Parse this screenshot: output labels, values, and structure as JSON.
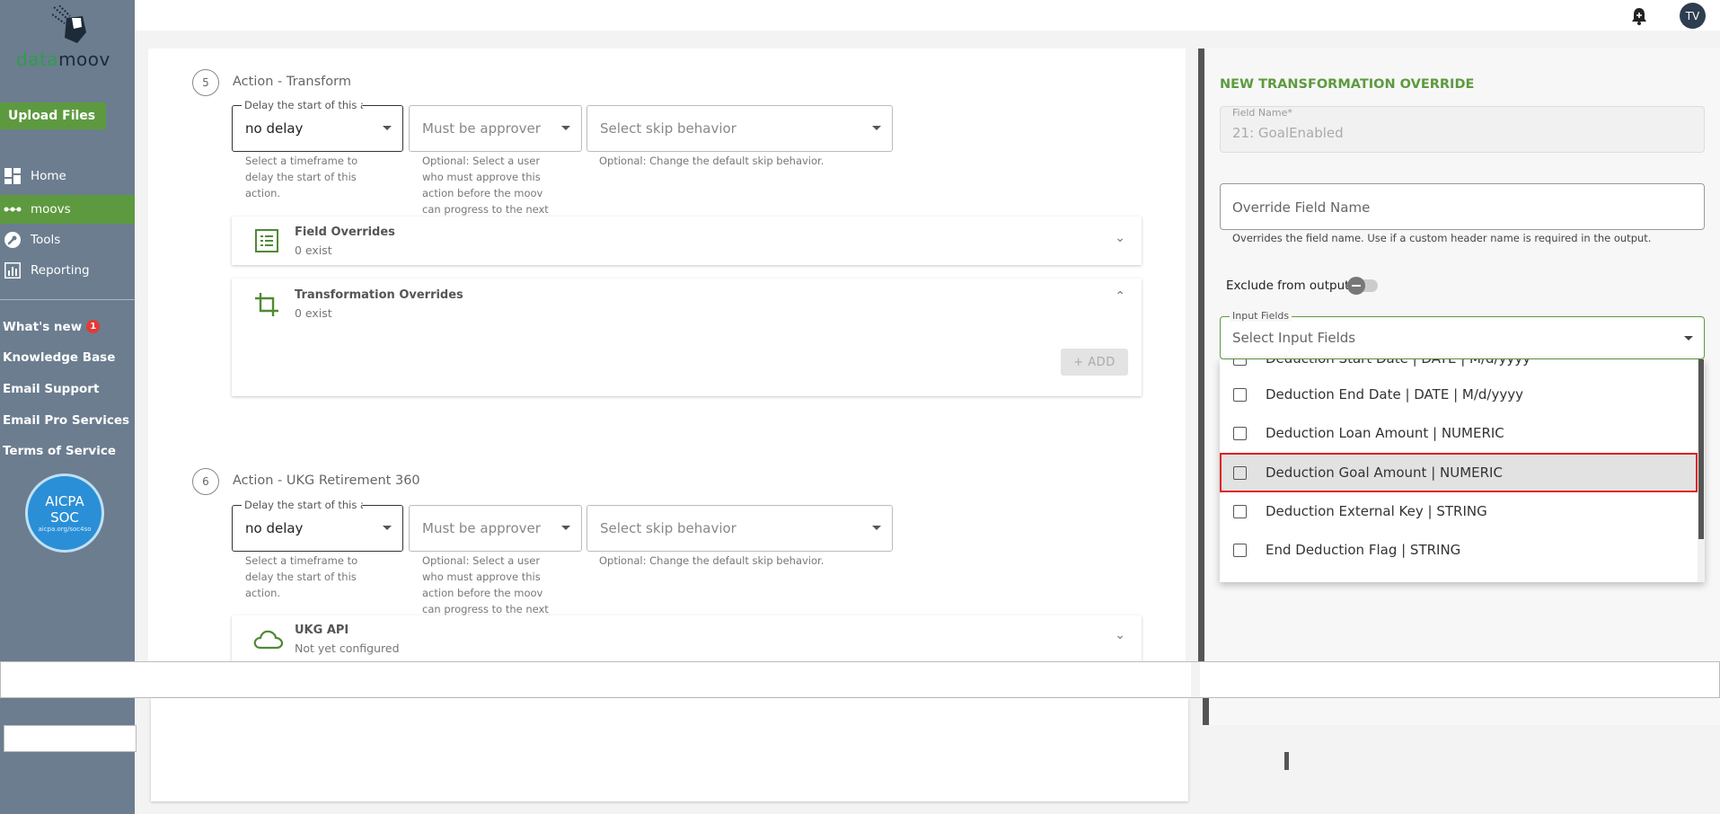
{
  "brand": {
    "logo_part1": "data",
    "logo_part2": "moov"
  },
  "sidebar": {
    "upload_label": "Upload Files",
    "nav": [
      {
        "label": "Home",
        "icon": "dashboard-icon"
      },
      {
        "label": "moovs",
        "icon": "dots-icon"
      },
      {
        "label": "Tools",
        "icon": "wrench-icon"
      },
      {
        "label": "Reporting",
        "icon": "bar-chart-icon"
      }
    ],
    "links": [
      {
        "label": "What's new",
        "badge": "1"
      },
      {
        "label": "Knowledge Base"
      },
      {
        "label": "Email Support"
      },
      {
        "label": "Email Pro Services"
      },
      {
        "label": "Terms of Service"
      }
    ],
    "aicpa": {
      "line1": "AICPA",
      "line2": "SOC",
      "sub": "aicpa.org/soc4so"
    }
  },
  "header": {
    "avatar_initials": "TV"
  },
  "actions": [
    {
      "number": "5",
      "title": "Action - Transform",
      "delay_label": "Delay the start of this action",
      "delay_value": "no delay",
      "delay_help": "Select a timeframe to delay the start of this action.",
      "approver_placeholder": "Must be approver",
      "approver_help": "Optional: Select a user who must approve this action before the moov can progress to the next",
      "skip_placeholder": "Select skip behavior",
      "skip_help": "Optional: Change the default skip behavior.",
      "cards": [
        {
          "title": "Field Overrides",
          "sub": "0 exist"
        },
        {
          "title": "Transformation Overrides",
          "sub": "0 exist",
          "add_label": "+ ADD"
        }
      ]
    },
    {
      "number": "6",
      "title": "Action - UKG Retirement 360",
      "delay_label": "Delay the start of this action",
      "delay_value": "no delay",
      "delay_help": "Select a timeframe to delay the start of this action.",
      "approver_placeholder": "Must be approver",
      "approver_help": "Optional: Select a user who must approve this action before the moov can progress to the next",
      "skip_placeholder": "Select skip behavior",
      "skip_help": "Optional: Change the default skip behavior.",
      "cards": [
        {
          "title": "UKG API",
          "sub": "Not yet configured"
        }
      ]
    }
  ],
  "override_panel": {
    "title": "NEW TRANSFORMATION OVERRIDE",
    "field_name_label": "Field Name*",
    "field_name_value": "21: GoalEnabled",
    "override_placeholder": "Override Field Name",
    "override_help": "Overrides the field name. Use if a custom header name is required in the output.",
    "exclude_label": "Exclude from output",
    "input_fields_label": "Input Fields",
    "input_fields_placeholder": "Select Input Fields",
    "options": [
      "Deduction Start Date | DATE | M/d/yyyy",
      "Deduction End Date | DATE | M/d/yyyy",
      "Deduction Loan Amount | NUMERIC",
      "Deduction Goal Amount | NUMERIC",
      "Deduction External Key | STRING",
      "End Deduction Flag | STRING"
    ],
    "highlighted_index": 3
  },
  "colors": {
    "accent": "#5d9a3f",
    "sidebar": "#6b7d8f",
    "highlight_border": "#e02020"
  }
}
